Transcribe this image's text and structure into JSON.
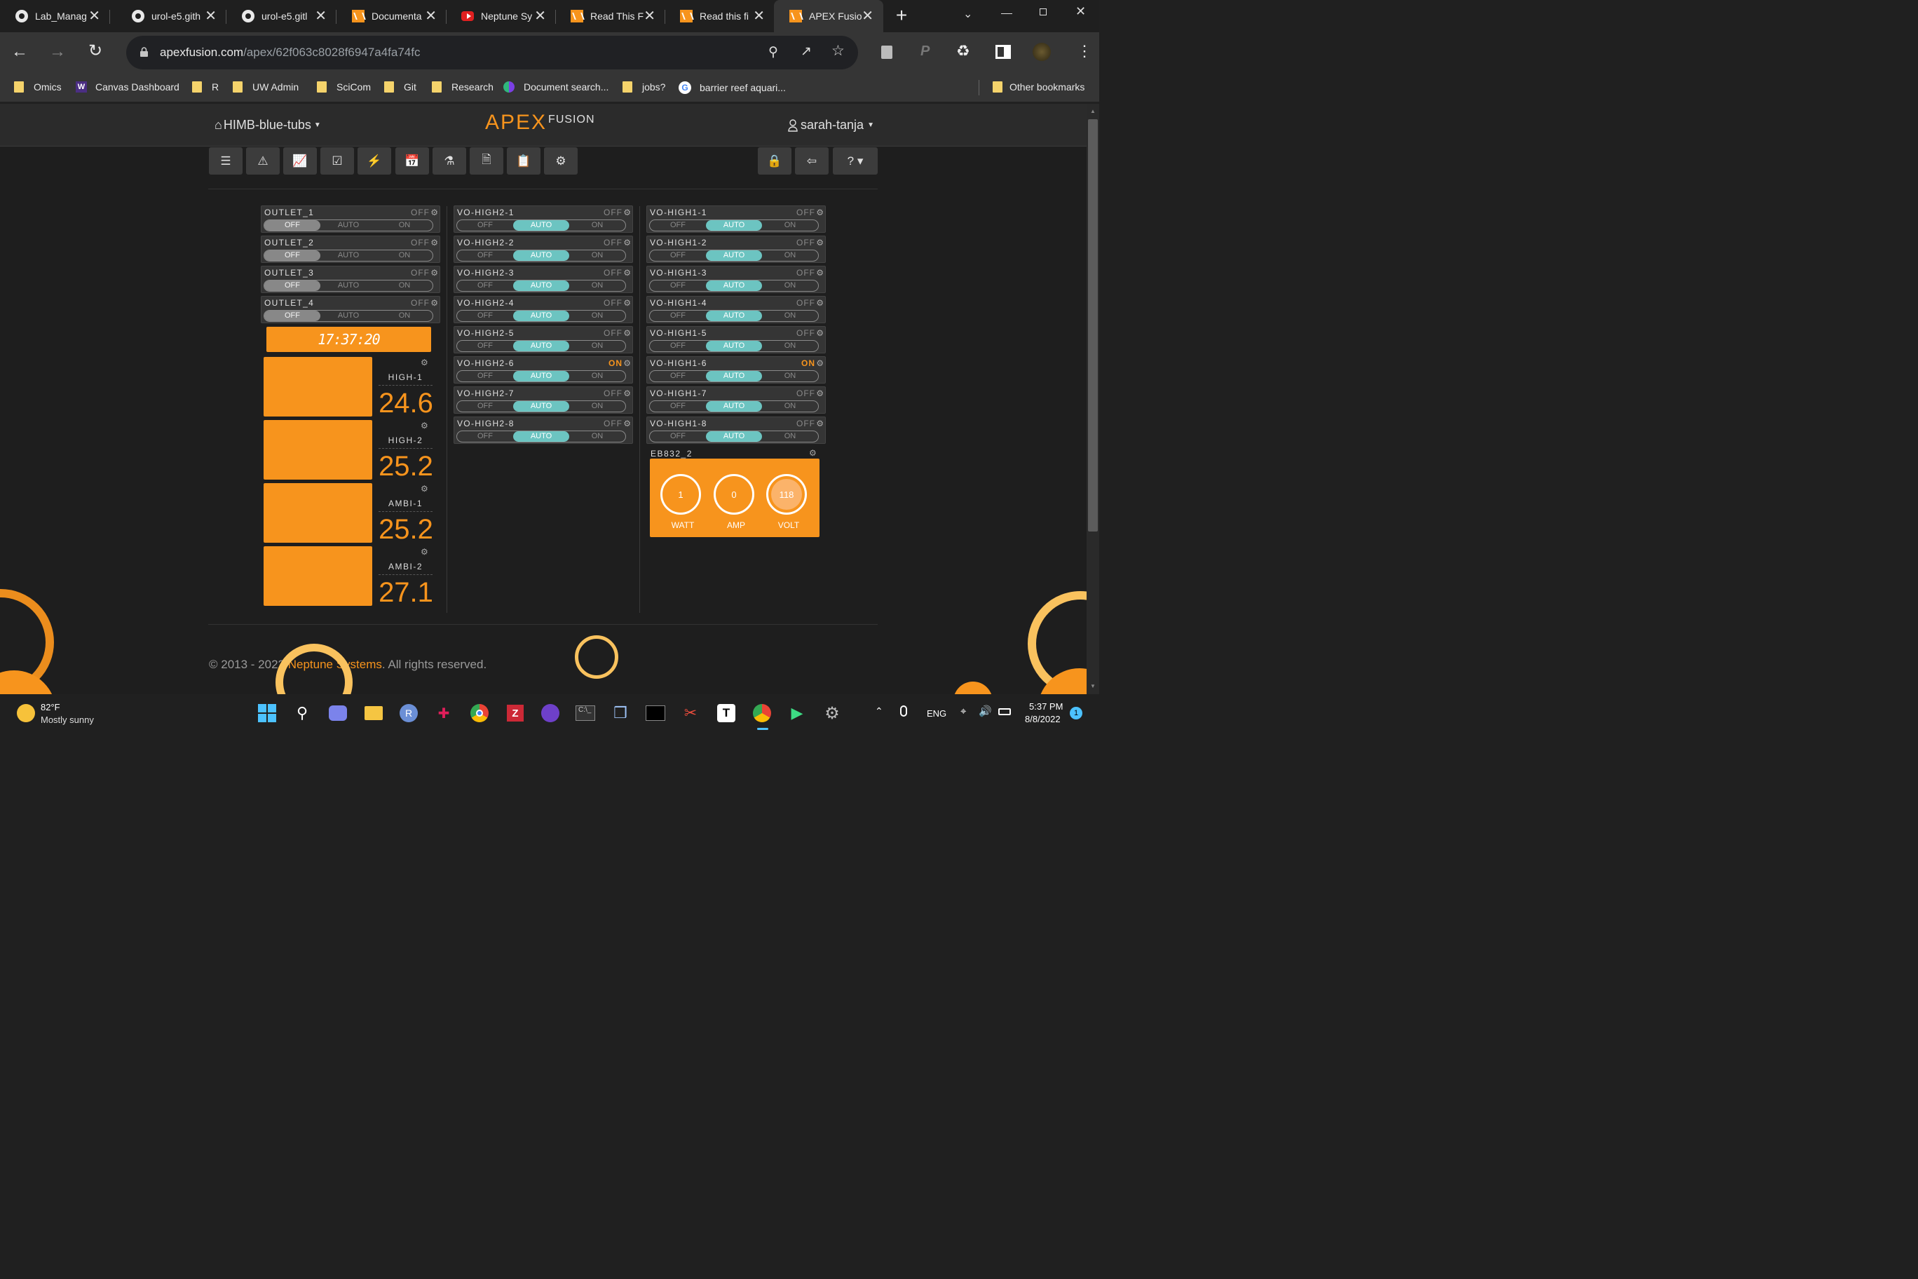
{
  "browser": {
    "tabs": [
      {
        "title": "Lab_Manag",
        "icon": "github-icon"
      },
      {
        "title": "urol-e5.gith",
        "icon": "github-icon"
      },
      {
        "title": "urol-e5.gitl",
        "icon": "github-icon"
      },
      {
        "title": "Documenta",
        "icon": "apex-icon"
      },
      {
        "title": "Neptune Sy",
        "icon": "youtube-icon"
      },
      {
        "title": "Read This F",
        "icon": "apex-icon"
      },
      {
        "title": "Read this fi",
        "icon": "apex-icon"
      },
      {
        "title": "APEX Fusio",
        "icon": "apex-icon",
        "active": true
      }
    ],
    "url_host": "apexfusion.com",
    "url_path": "/apex/62f063c8028f6947a4fa74fc",
    "bookmarks": [
      {
        "label": "Omics",
        "icon": "folder-icon"
      },
      {
        "label": "Canvas Dashboard",
        "icon": "uw-icon"
      },
      {
        "label": "R",
        "icon": "folder-icon"
      },
      {
        "label": "UW Admin",
        "icon": "folder-icon"
      },
      {
        "label": "SciCom",
        "icon": "folder-icon"
      },
      {
        "label": "Git",
        "icon": "folder-icon"
      },
      {
        "label": "Research",
        "icon": "folder-icon"
      },
      {
        "label": "Document search...",
        "icon": "doc-search-icon"
      },
      {
        "label": "jobs?",
        "icon": "folder-icon"
      },
      {
        "label": "barrier reef aquari...",
        "icon": "google-icon"
      }
    ],
    "other_bookmarks": "Other bookmarks"
  },
  "apex": {
    "location": "HIMB-blue-tubs",
    "logo_main": "APEX",
    "logo_sub": "FUSION",
    "user": "sarah-tanja",
    "clock": "17:37:20",
    "eb_name": "EB832_2",
    "footer": {
      "prefix": "© 2013 - 2022 ",
      "link": "Neptune Systems",
      "suffix": ". All rights reserved."
    }
  },
  "toggle_labels": {
    "off": "OFF",
    "auto": "AUTO",
    "on": "ON"
  },
  "outlets": {
    "col1": [
      {
        "name": "OUTLET_1",
        "status": "OFF",
        "mode": "off"
      },
      {
        "name": "OUTLET_2",
        "status": "OFF",
        "mode": "off"
      },
      {
        "name": "OUTLET_3",
        "status": "OFF",
        "mode": "off"
      },
      {
        "name": "OUTLET_4",
        "status": "OFF",
        "mode": "off"
      }
    ],
    "col2": [
      {
        "name": "VO-HIGH2-1",
        "status": "OFF",
        "mode": "auto"
      },
      {
        "name": "VO-HIGH2-2",
        "status": "OFF",
        "mode": "auto"
      },
      {
        "name": "VO-HIGH2-3",
        "status": "OFF",
        "mode": "auto"
      },
      {
        "name": "VO-HIGH2-4",
        "status": "OFF",
        "mode": "auto"
      },
      {
        "name": "VO-HIGH2-5",
        "status": "OFF",
        "mode": "auto"
      },
      {
        "name": "VO-HIGH2-6",
        "status": "ON",
        "mode": "auto"
      },
      {
        "name": "VO-HIGH2-7",
        "status": "OFF",
        "mode": "auto"
      },
      {
        "name": "VO-HIGH2-8",
        "status": "OFF",
        "mode": "auto"
      }
    ],
    "col3": [
      {
        "name": "VO-HIGH1-1",
        "status": "OFF",
        "mode": "auto"
      },
      {
        "name": "VO-HIGH1-2",
        "status": "OFF",
        "mode": "auto"
      },
      {
        "name": "VO-HIGH1-3",
        "status": "OFF",
        "mode": "auto"
      },
      {
        "name": "VO-HIGH1-4",
        "status": "OFF",
        "mode": "auto"
      },
      {
        "name": "VO-HIGH1-5",
        "status": "OFF",
        "mode": "auto"
      },
      {
        "name": "VO-HIGH1-6",
        "status": "ON",
        "mode": "auto"
      },
      {
        "name": "VO-HIGH1-7",
        "status": "OFF",
        "mode": "auto"
      },
      {
        "name": "VO-HIGH1-8",
        "status": "OFF",
        "mode": "auto"
      }
    ]
  },
  "probes": [
    {
      "name": "HIGH-1",
      "value": "24.6"
    },
    {
      "name": "HIGH-2",
      "value": "25.2"
    },
    {
      "name": "AMBI-1",
      "value": "25.2"
    },
    {
      "name": "AMBI-2",
      "value": "27.1"
    }
  ],
  "meters": [
    {
      "value": "1",
      "label": "WATT"
    },
    {
      "value": "0",
      "label": "AMP"
    },
    {
      "value": "118",
      "label": "VOLT"
    }
  ],
  "taskbar": {
    "weather_temp": "82°F",
    "weather_desc": "Mostly sunny",
    "lang": "ENG",
    "time": "5:37 PM",
    "date": "8/8/2022",
    "notifications": "1"
  },
  "colors": {
    "accent": "#f7941d",
    "auto_teal": "#6cc4c1"
  }
}
